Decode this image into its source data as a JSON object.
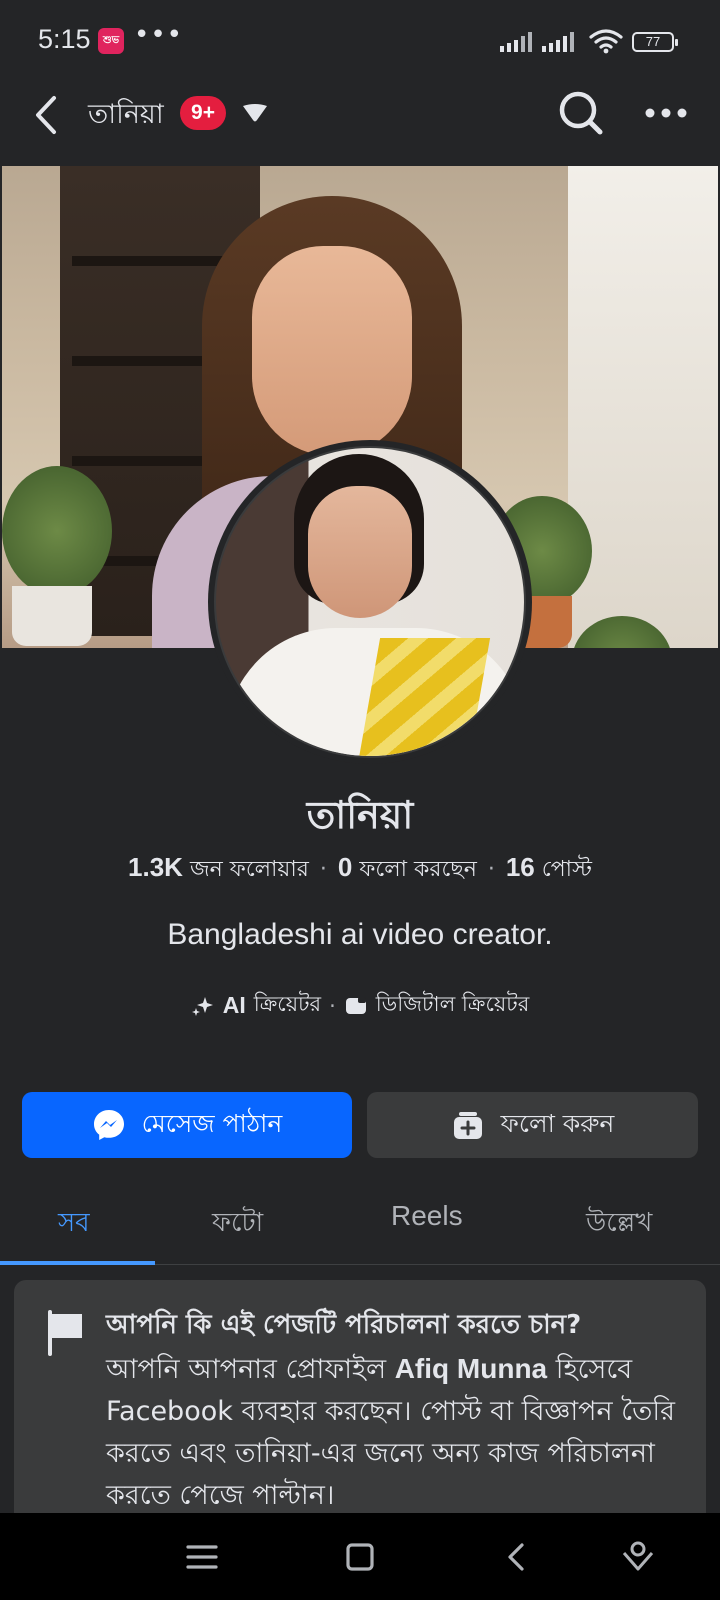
{
  "status_bar": {
    "time": "5:15",
    "app_icon_text": "শুভ",
    "overflow_dots": "•••",
    "battery": "77"
  },
  "header": {
    "title": "তানিয়া",
    "badge": "9+"
  },
  "profile": {
    "name": "তানিয়া",
    "followers_count": "1.3K",
    "followers_label": "জন ফলোয়ার",
    "following_count": "0",
    "following_label": "ফলো করছেন",
    "posts_count": "16",
    "posts_label": "পোস্ট",
    "separator": "·",
    "bio": "Bangladeshi ai video creator.",
    "category_ai": "AI",
    "category_1": "ক্রিয়েটর",
    "category_2": "ডিজিটাল ক্রিয়েটর"
  },
  "actions": {
    "message_label": "মেসেজ পাঠান",
    "follow_label": "ফলো করুন"
  },
  "tabs": [
    {
      "label": "সব",
      "active": true
    },
    {
      "label": "ফটো",
      "active": false
    },
    {
      "label": "Reels",
      "active": false
    },
    {
      "label": "উল্লেখ",
      "active": false
    }
  ],
  "manage_card": {
    "title": "আপনি কি এই পেজটি পরিচালনা করতে চান?",
    "body_prefix": "আপনি আপনার প্রোফাইল",
    "profile_name": "Afiq Munna",
    "body_suffix": "হিসেবে Facebook ব্যবহার করছেন। পোস্ট বা বিজ্ঞাপন তৈরি করতে এবং তানিয়া-এর জন্যে অন্য কাজ পরিচালনা করতে পেজে পাল্টান।"
  },
  "colors": {
    "background": "#242527",
    "primary_blue": "#0866ff",
    "tab_active": "#4599ff",
    "badge_red": "#e41e3f",
    "card_bg": "#3a3b3c"
  },
  "icons": [
    "back-icon",
    "caret-down-icon",
    "search-icon",
    "more-icon",
    "messenger-icon",
    "follow-icon",
    "sparkle-icon",
    "category-icon",
    "flag-icon",
    "menu-icon",
    "home-icon",
    "nav-back-icon",
    "assistant-icon"
  ]
}
